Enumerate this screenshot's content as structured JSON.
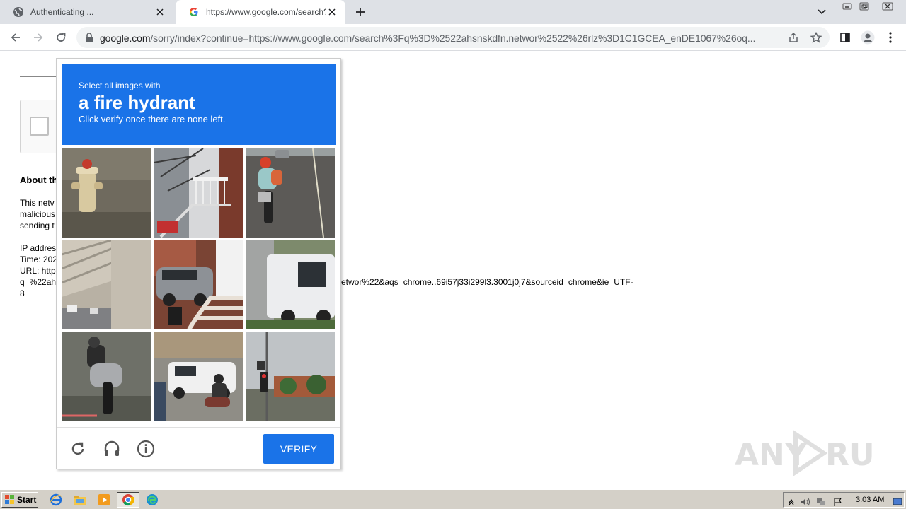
{
  "browser": {
    "tabs": [
      {
        "title": "Authenticating ...",
        "favicon": "globe-icon",
        "active": false
      },
      {
        "title": "https://www.google.com/search?q=",
        "favicon": "google-g-icon",
        "active": true
      }
    ],
    "address_bar": {
      "host": "google.com",
      "path": "/sorry/index?continue=https://www.google.com/search%3Fq%3D%2522ahsnskdfn.networ%2522%26rlz%3D1C1GCEA_enDE1067%26oq..."
    }
  },
  "page": {
    "about_title": "About th",
    "lines": [
      "This netv",
      "malicious",
      "sending t",
      "IP addres",
      "Time: 202",
      "URL: http",
      "q=%22ah",
      "8"
    ],
    "url_continuation": "etwor%22&aqs=chrome..69i57j33i299l3.3001j0j7&sourceid=chrome&ie=UTF-"
  },
  "recaptcha": {
    "instruction_prefix": "Select all images with",
    "target_object": "a fire hydrant",
    "instruction_suffix": "Click verify once there are none left.",
    "tiles": [
      {
        "id": 1,
        "depicts": "fire hydrant"
      },
      {
        "id": 2,
        "depicts": "house stairs"
      },
      {
        "id": 3,
        "depicts": "motorcycle rider"
      },
      {
        "id": 4,
        "depicts": "overpass"
      },
      {
        "id": 5,
        "depicts": "car and stairs"
      },
      {
        "id": 6,
        "depicts": "white truck"
      },
      {
        "id": 7,
        "depicts": "motorcycle"
      },
      {
        "id": 8,
        "depicts": "van and motorcycle"
      },
      {
        "id": 9,
        "depicts": "traffic light"
      }
    ],
    "verify_label": "VERIFY",
    "accent": "#1a73e8"
  },
  "watermark": {
    "text": "ANY RUN"
  },
  "taskbar": {
    "start_label": "Start",
    "clock": "3:03 AM"
  }
}
